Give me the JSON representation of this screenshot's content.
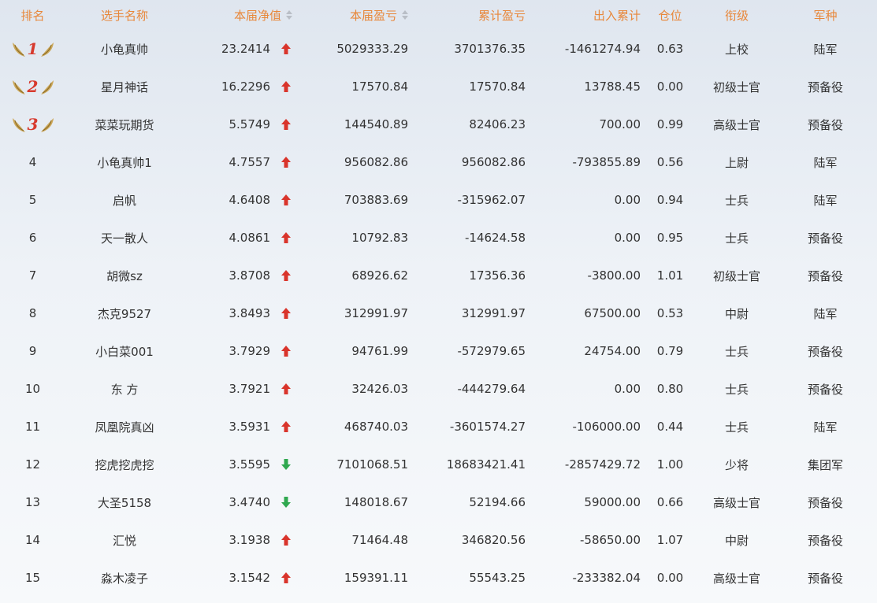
{
  "headers": {
    "rank": "排名",
    "name": "选手名称",
    "nav": "本届净值",
    "profit": "本届盈亏",
    "cumulative": "累计盈亏",
    "flow": "出入累计",
    "position": "仓位",
    "title": "衔级",
    "army": "军种"
  },
  "colors": {
    "header": "#e8873a",
    "up": "#d9342b",
    "down": "#2fa84f",
    "medal_num": "#d73a2e",
    "wing": "#c9a14a"
  },
  "rows": [
    {
      "rank": "1",
      "medal": true,
      "name": "小龟真帅",
      "nav": "23.2414",
      "trend": "up",
      "profit": "5029333.29",
      "cumulative": "3701376.35",
      "flow": "-1461274.94",
      "position": "0.63",
      "title": "上校",
      "army": "陆军"
    },
    {
      "rank": "2",
      "medal": true,
      "name": "星月神话",
      "nav": "16.2296",
      "trend": "up",
      "profit": "17570.84",
      "cumulative": "17570.84",
      "flow": "13788.45",
      "position": "0.00",
      "title": "初级士官",
      "army": "预备役"
    },
    {
      "rank": "3",
      "medal": true,
      "name": "菜菜玩期货",
      "nav": "5.5749",
      "trend": "up",
      "profit": "144540.89",
      "cumulative": "82406.23",
      "flow": "700.00",
      "position": "0.99",
      "title": "高级士官",
      "army": "预备役"
    },
    {
      "rank": "4",
      "medal": false,
      "name": "小龟真帅1",
      "nav": "4.7557",
      "trend": "up",
      "profit": "956082.86",
      "cumulative": "956082.86",
      "flow": "-793855.89",
      "position": "0.56",
      "title": "上尉",
      "army": "陆军"
    },
    {
      "rank": "5",
      "medal": false,
      "name": "启帆",
      "nav": "4.6408",
      "trend": "up",
      "profit": "703883.69",
      "cumulative": "-315962.07",
      "flow": "0.00",
      "position": "0.94",
      "title": "士兵",
      "army": "陆军"
    },
    {
      "rank": "6",
      "medal": false,
      "name": "天一散人",
      "nav": "4.0861",
      "trend": "up",
      "profit": "10792.83",
      "cumulative": "-14624.58",
      "flow": "0.00",
      "position": "0.95",
      "title": "士兵",
      "army": "预备役"
    },
    {
      "rank": "7",
      "medal": false,
      "name": "胡微sz",
      "nav": "3.8708",
      "trend": "up",
      "profit": "68926.62",
      "cumulative": "17356.36",
      "flow": "-3800.00",
      "position": "1.01",
      "title": "初级士官",
      "army": "预备役"
    },
    {
      "rank": "8",
      "medal": false,
      "name": "杰克9527",
      "nav": "3.8493",
      "trend": "up",
      "profit": "312991.97",
      "cumulative": "312991.97",
      "flow": "67500.00",
      "position": "0.53",
      "title": "中尉",
      "army": "陆军"
    },
    {
      "rank": "9",
      "medal": false,
      "name": "小白菜001",
      "nav": "3.7929",
      "trend": "up",
      "profit": "94761.99",
      "cumulative": "-572979.65",
      "flow": "24754.00",
      "position": "0.79",
      "title": "士兵",
      "army": "预备役"
    },
    {
      "rank": "10",
      "medal": false,
      "name": "东 方",
      "nav": "3.7921",
      "trend": "up",
      "profit": "32426.03",
      "cumulative": "-444279.64",
      "flow": "0.00",
      "position": "0.80",
      "title": "士兵",
      "army": "预备役"
    },
    {
      "rank": "11",
      "medal": false,
      "name": "凤凰院真凶",
      "nav": "3.5931",
      "trend": "up",
      "profit": "468740.03",
      "cumulative": "-3601574.27",
      "flow": "-106000.00",
      "position": "0.44",
      "title": "士兵",
      "army": "陆军"
    },
    {
      "rank": "12",
      "medal": false,
      "name": "挖虎挖虎挖",
      "nav": "3.5595",
      "trend": "down",
      "profit": "7101068.51",
      "cumulative": "18683421.41",
      "flow": "-2857429.72",
      "position": "1.00",
      "title": "少将",
      "army": "集团军"
    },
    {
      "rank": "13",
      "medal": false,
      "name": "大圣5158",
      "nav": "3.4740",
      "trend": "down",
      "profit": "148018.67",
      "cumulative": "52194.66",
      "flow": "59000.00",
      "position": "0.66",
      "title": "高级士官",
      "army": "预备役"
    },
    {
      "rank": "14",
      "medal": false,
      "name": "汇悦",
      "nav": "3.1938",
      "trend": "up",
      "profit": "71464.48",
      "cumulative": "346820.56",
      "flow": "-58650.00",
      "position": "1.07",
      "title": "中尉",
      "army": "预备役"
    },
    {
      "rank": "15",
      "medal": false,
      "name": "淼木凌子",
      "nav": "3.1542",
      "trend": "up",
      "profit": "159391.11",
      "cumulative": "55543.25",
      "flow": "-233382.04",
      "position": "0.00",
      "title": "高级士官",
      "army": "预备役"
    }
  ]
}
